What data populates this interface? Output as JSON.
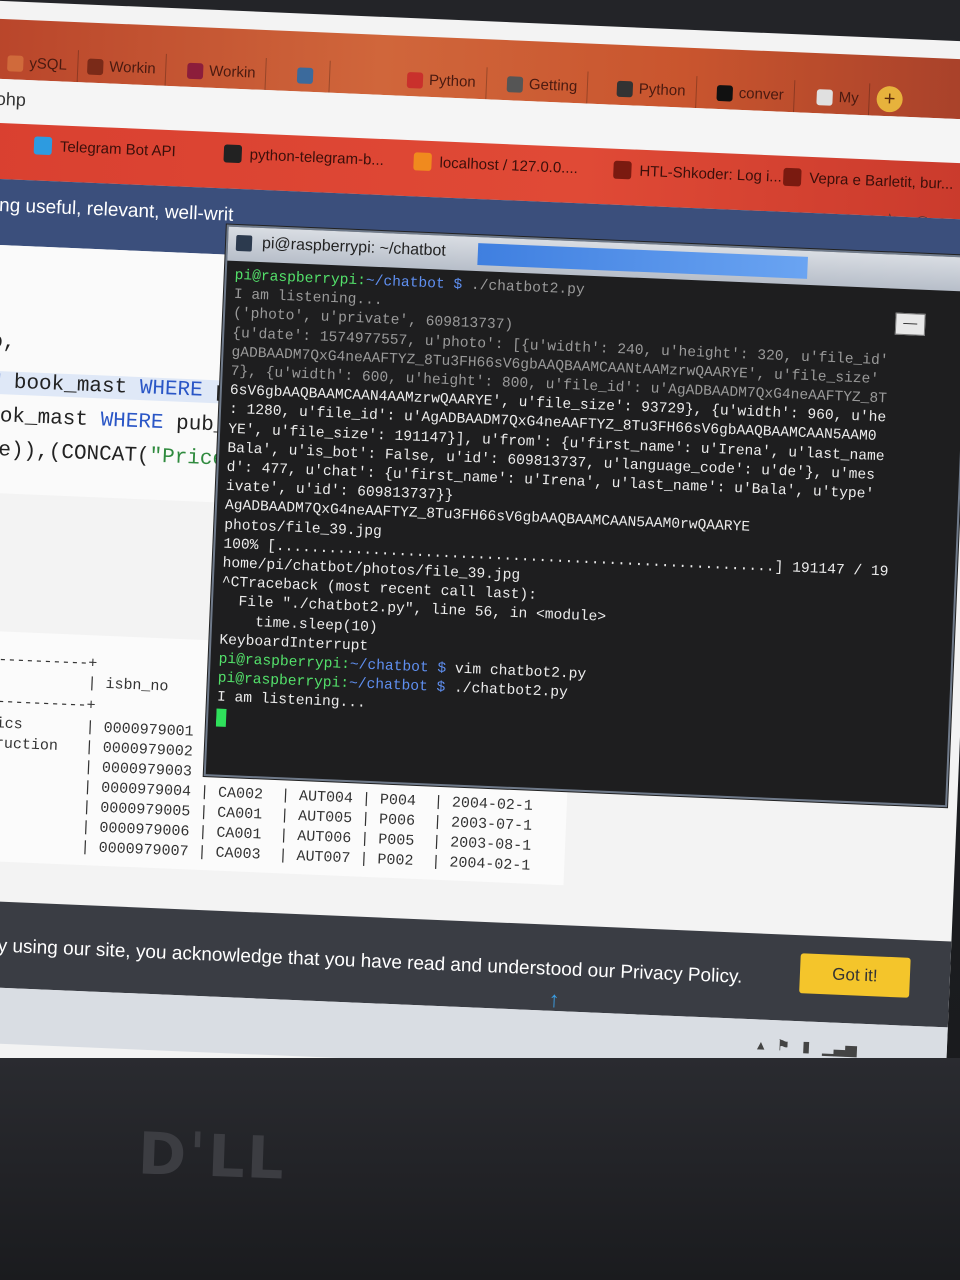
{
  "browser": {
    "tabs": [
      {
        "label": "ySQL",
        "icon": "mysql-icon",
        "color": "#d06a3b"
      },
      {
        "label": "Workin",
        "icon": "dg-icon",
        "color": "#7a2a18"
      },
      {
        "label": "Workin",
        "icon": "v-icon",
        "color": "#8c1d3b"
      },
      {
        "label": "",
        "icon": "gfg-icon",
        "color": "#3b6a9c"
      },
      {
        "label": "Python",
        "icon": "python-icon",
        "color": "#c9302c"
      },
      {
        "label": "Getting",
        "icon": "globe-icon",
        "color": "#555555"
      },
      {
        "label": "Python",
        "icon": "python-icon",
        "color": "#333333"
      },
      {
        "label": "conver",
        "icon": "github-icon",
        "color": "#111111"
      },
      {
        "label": "My",
        "icon": "w3-icon",
        "color": "#e0e0e0"
      }
    ],
    "url_fragment": "ohp",
    "bookmarks": [
      {
        "label": "io...",
        "icon": "folder-icon"
      },
      {
        "label": "Telegram Bot API",
        "icon": "telegram-icon"
      },
      {
        "label": "python-telegram-b...",
        "icon": "github-icon"
      },
      {
        "label": "localhost / 127.0.0....",
        "icon": "pma-icon"
      },
      {
        "label": "HTL-Shkoder: Log i...",
        "icon": "bookmark-icon"
      },
      {
        "label": "Vepra e Barletit, bur...",
        "icon": "bookmark-icon"
      }
    ]
  },
  "page": {
    "banner_text": "iting useful, relevant, well-writ",
    "code_lines": [
      "no,",
      "OM book_mast WHERE pu",
      "book_mast WHERE pub_I",
      "age)),(CONCAT(\"Price:"
    ],
    "results": {
      "header": "| isbn_no",
      "rows": [
        {
          "name": "ynamics",
          "isbn": "0000979001",
          "cate": "",
          "aut": "",
          "pub": "",
          "date": ""
        },
        {
          "name": "onstruction",
          "isbn": "0000979002",
          "cate": "",
          "aut": "",
          "pub": "",
          "date": ""
        },
        {
          "name": "",
          "isbn": "0000979003",
          "cate": "",
          "aut": "",
          "pub": "",
          "date": ""
        },
        {
          "name": "s",
          "isbn": "0000979004",
          "cate": "CA002",
          "aut": "AUT004",
          "pub": "P004",
          "date": "2004-02-1"
        },
        {
          "name": "",
          "isbn": "0000979005",
          "cate": "CA001",
          "aut": "AUT005",
          "pub": "P006",
          "date": "2003-07-1"
        },
        {
          "name": "",
          "isbn": "0000979006",
          "cate": "CA001",
          "aut": "AUT006",
          "pub": "P005",
          "date": "2003-08-1"
        },
        {
          "name": "",
          "isbn": "0000979007",
          "cate": "CA003",
          "aut": "AUT007",
          "pub": "P002",
          "date": "2004-02-1"
        }
      ]
    },
    "cookie_text": "ds. By using our site, you acknowledge that you have read and understood our Privacy Policy.",
    "got_it_label": "Got it!"
  },
  "terminal": {
    "title": "pi@raspberrypi: ~/chatbot",
    "prompt_user": "pi@raspberrypi",
    "prompt_path": "~/chatbot",
    "lines": [
      {
        "type": "prompt",
        "cmd": "./chatbot2.py",
        "faded": true
      },
      {
        "type": "text",
        "text": "I am listening...",
        "faded": true
      },
      {
        "type": "text",
        "text": "('photo', u'private', 609813737)",
        "faded": true
      },
      {
        "type": "text",
        "text": "{u'date': 1574977557, u'photo': [{u'width': 240, u'height': 320, u'file_id'",
        "faded": true
      },
      {
        "type": "text",
        "text": "gADBAADM7QxG4neAAFTYZ_8Tu3FH66sV6gbAAQBAAMCAANtAAMzrwQAARYE', u'file_size'",
        "faded": true
      },
      {
        "type": "text",
        "text": "7}, {u'width': 600, u'height': 800, u'file_id': u'AgADBAADM7QxG4neAAFTYZ_8T",
        "faded": true
      },
      {
        "type": "text",
        "text": "6sV6gbAAQBAAMCAAN4AAMzrwQAARYE', u'file_size': 93729}, {u'width': 960, u'he",
        "faded": false
      },
      {
        "type": "text",
        "text": ": 1280, u'file_id': u'AgADBAADM7QxG4neAAFTYZ_8Tu3FH66sV6gbAAQBAAMCAAN5AAM0",
        "faded": false
      },
      {
        "type": "text",
        "text": "YE', u'file_size': 191147}], u'from': {u'first_name': u'Irena', u'last_name",
        "faded": false
      },
      {
        "type": "text",
        "text": "Bala', u'is_bot': False, u'id': 609813737, u'language_code': u'de'}, u'mes",
        "faded": false
      },
      {
        "type": "text",
        "text": "d': 477, u'chat': {u'first_name': u'Irena', u'last_name': u'Bala', u'type'",
        "faded": false
      },
      {
        "type": "text",
        "text": "ivate', u'id': 609813737}}",
        "faded": false
      },
      {
        "type": "text",
        "text": "AgADBAADM7QxG4neAAFTYZ_8Tu3FH66sV6gbAAQBAAMCAAN5AAM0rwQAARYE",
        "faded": false
      },
      {
        "type": "text",
        "text": "photos/file_39.jpg",
        "faded": false
      },
      {
        "type": "text",
        "text": "100% [.........................................................] 191147 / 19",
        "faded": false
      },
      {
        "type": "text",
        "text": "home/pi/chatbot/photos/file_39.jpg",
        "faded": false
      },
      {
        "type": "text",
        "text": "^CTraceback (most recent call last):",
        "faded": false
      },
      {
        "type": "text",
        "text": "  File \"./chatbot2.py\", line 56, in <module>",
        "faded": false
      },
      {
        "type": "text",
        "text": "    time.sleep(10)",
        "faded": false
      },
      {
        "type": "text",
        "text": "KeyboardInterrupt",
        "faded": false
      },
      {
        "type": "prompt",
        "cmd": "vim chatbot2.py",
        "faded": false
      },
      {
        "type": "prompt",
        "cmd": "./chatbot2.py",
        "faded": false
      },
      {
        "type": "text",
        "text": "I am listening...",
        "faded": false
      },
      {
        "type": "cursor",
        "text": "",
        "faded": false
      }
    ]
  },
  "hardware": {
    "brand": "DELL"
  }
}
